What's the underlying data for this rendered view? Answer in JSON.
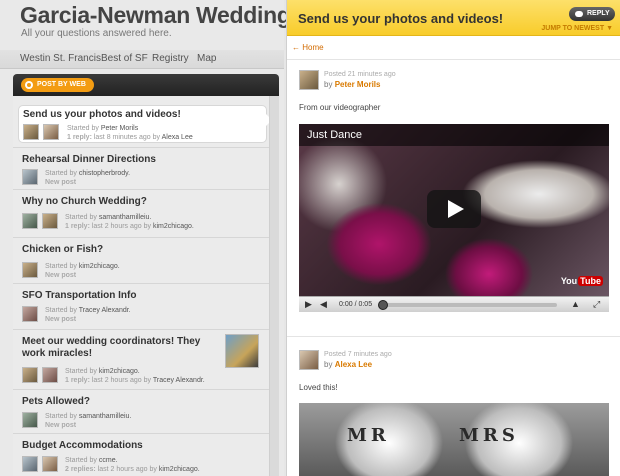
{
  "site": {
    "title": "Garcia-Newman Wedding",
    "tagline": "All your questions answered here."
  },
  "nav": {
    "items": [
      "Westin St. Francis",
      "Best of SF",
      "Registry",
      "Map"
    ]
  },
  "toolbar": {
    "post_by_web": "POST BY WEB"
  },
  "topics": [
    {
      "title": "Send us your photos and videos!",
      "started_by": "Peter Morils",
      "reply_count": "1 reply:",
      "last_text": "last 8 minutes ago",
      "last_by": "Alexa Lee"
    },
    {
      "title": "Rehearsal Dinner Directions",
      "started_by": "chistopherbrody.",
      "status": "New post"
    },
    {
      "title": "Why no Church Wedding?",
      "started_by": "samanthamilleiu.",
      "reply_count": "1 reply:",
      "last_text": "last 2 hours ago",
      "last_by": "kim2chicago."
    },
    {
      "title": "Chicken or Fish?",
      "started_by": "kim2chicago.",
      "status": "New post"
    },
    {
      "title": "SFO Transportation Info",
      "started_by": "Tracey Alexandr.",
      "status": "New post"
    },
    {
      "title": "Meet our wedding coordinators! They work miracles!",
      "started_by": "kim2chicago.",
      "reply_count": "1 reply:",
      "last_text": "last 2 hours ago",
      "last_by": "Tracey Alexandr."
    },
    {
      "title": "Pets Allowed?",
      "started_by": "samanthamilleiu.",
      "status": "New post"
    },
    {
      "title": "Budget Accommodations",
      "started_by": "ccme.",
      "reply_count": "2 replies:",
      "last_text": "last 2 hours ago",
      "last_by": "kim2chicago."
    }
  ],
  "labels": {
    "started_by": "Started by",
    "by": "by"
  },
  "thread": {
    "title": "Send us your photos and videos!",
    "reply": "REPLY",
    "jump": "JUMP TO NEWEST ▼",
    "home": "← Home",
    "posts": [
      {
        "posted": "Posted 21 minutes ago",
        "author": "Peter Morils",
        "body": "From our videographer"
      },
      {
        "posted": "Posted 7 minutes ago",
        "author": "Alexa Lee",
        "body": "Loved this!"
      }
    ],
    "video": {
      "title": "Just Dance",
      "time": "0:00 / 0:05",
      "brand_you": "You",
      "brand_tube": "Tube"
    },
    "photo_text": {
      "left": "MR",
      "right": "MRS"
    }
  },
  "colors": {
    "accent_orange": "#f39c12",
    "header_yellow": "#f8cc2a",
    "author_orange": "#d97a00"
  }
}
